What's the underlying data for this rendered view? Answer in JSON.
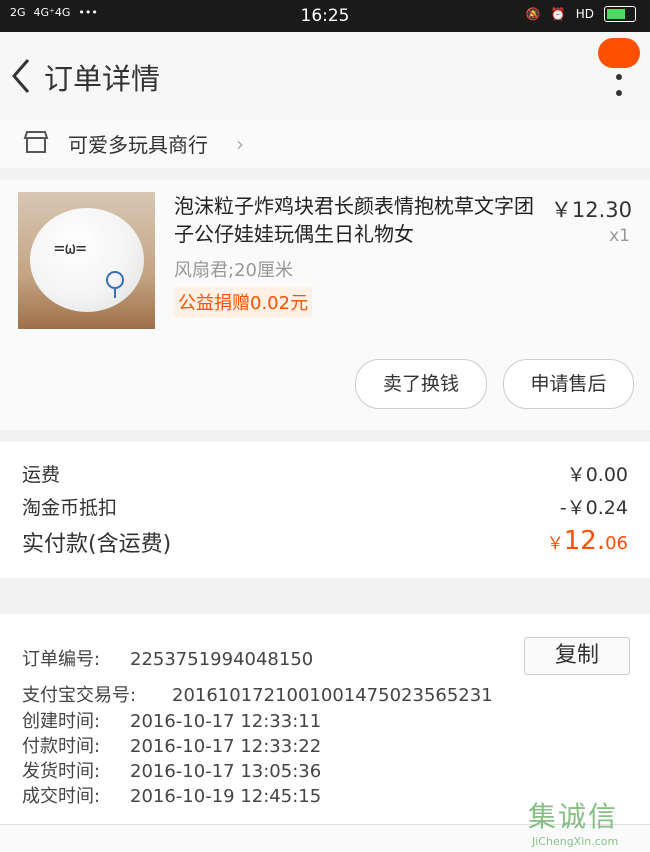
{
  "status_bar": {
    "signal_1": "2G",
    "signal_2": "4G⁺4G",
    "dots": "•••",
    "time": "16:25",
    "hd": "HD"
  },
  "nav": {
    "title": "订单详情"
  },
  "shop": {
    "name": "可爱多玩具商行",
    "arrow": "›"
  },
  "item": {
    "title": "泡沫粒子炸鸡块君长颜表情抱枕草文字团子公仔娃娃玩偶生日礼物女",
    "price": "￥12.30",
    "qty": "x1",
    "spec": "风扇君;20厘米",
    "charity": "公益捐赠0.02元",
    "thumb_face": "=ω="
  },
  "actions": {
    "sell_label": "卖了换钱",
    "aftersale_label": "申请售后"
  },
  "fees": {
    "shipping_label": "运费",
    "shipping_value": "￥0.00",
    "coins_label": "淘金币抵扣",
    "coins_value": "-￥0.24",
    "total_label": "实付款(含运费)",
    "total_yen": "￥",
    "total_int": "12.",
    "total_dec": "06"
  },
  "order": {
    "order_no_label": "订单编号:",
    "order_no": "2253751994048150",
    "copy_label": "复制",
    "alipay_label": "支付宝交易号:",
    "alipay_no": "2016101721001001475023565231",
    "created_label": "创建时间:",
    "created": "2016-10-17  12:33:11",
    "paid_label": "付款时间:",
    "paid": "2016-10-17  12:33:22",
    "shipped_label": "发货时间:",
    "shipped": "2016-10-17  13:05:36",
    "completed_label": "成交时间:",
    "completed": "2016-10-19  12:45:15"
  },
  "watermark": {
    "main": "集诚信",
    "sub": "JiChengXin.com"
  },
  "colors": {
    "accent": "#ff5000",
    "status_bg": "#1a1a1a"
  }
}
